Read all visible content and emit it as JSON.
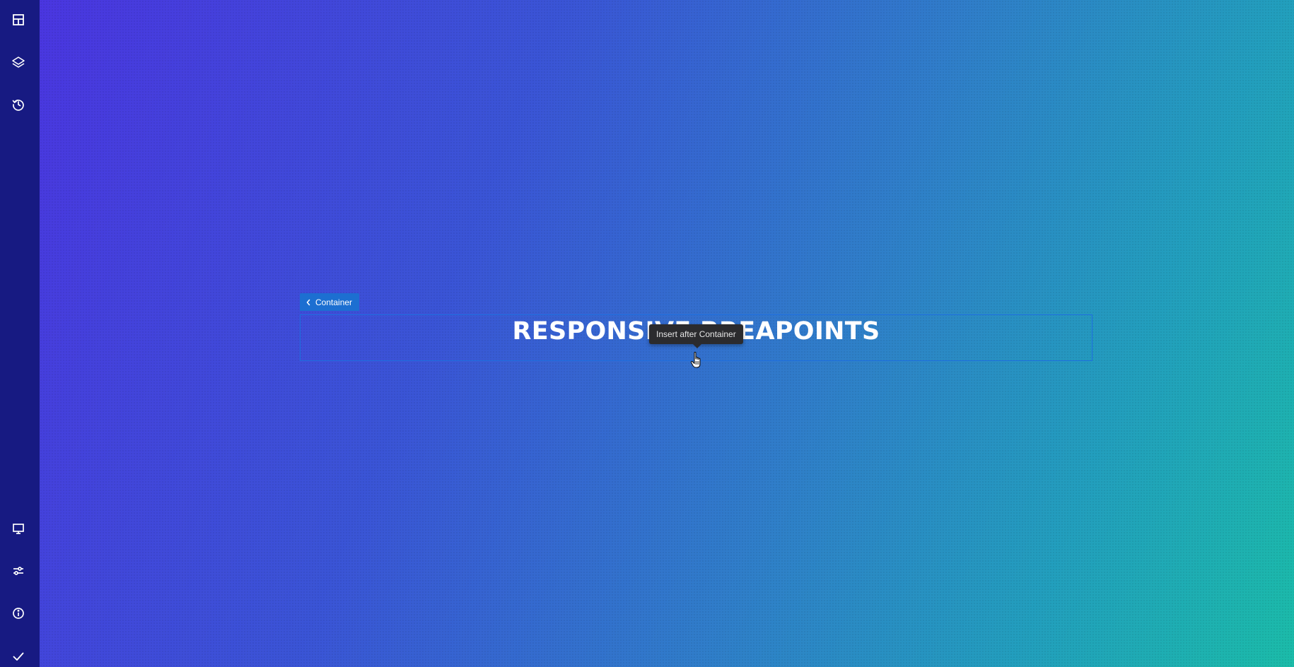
{
  "sidebar": {
    "top_items": [
      {
        "icon": "layout-icon"
      },
      {
        "icon": "layers-icon"
      },
      {
        "icon": "history-icon"
      }
    ],
    "bottom_items": [
      {
        "icon": "monitor-icon"
      },
      {
        "icon": "sliders-icon"
      },
      {
        "icon": "info-icon"
      },
      {
        "icon": "check-icon"
      }
    ]
  },
  "canvas": {
    "gradient_colors": [
      "#4a36e0",
      "#3a55d6",
      "#2f7fc9",
      "#229fbd",
      "#1bbca9"
    ],
    "selection_color": "#1e6fe0",
    "container_tag": {
      "label": "Container"
    },
    "heading": "RESPONSIVE BREAPOINTS",
    "tooltip": "Insert after Container"
  }
}
